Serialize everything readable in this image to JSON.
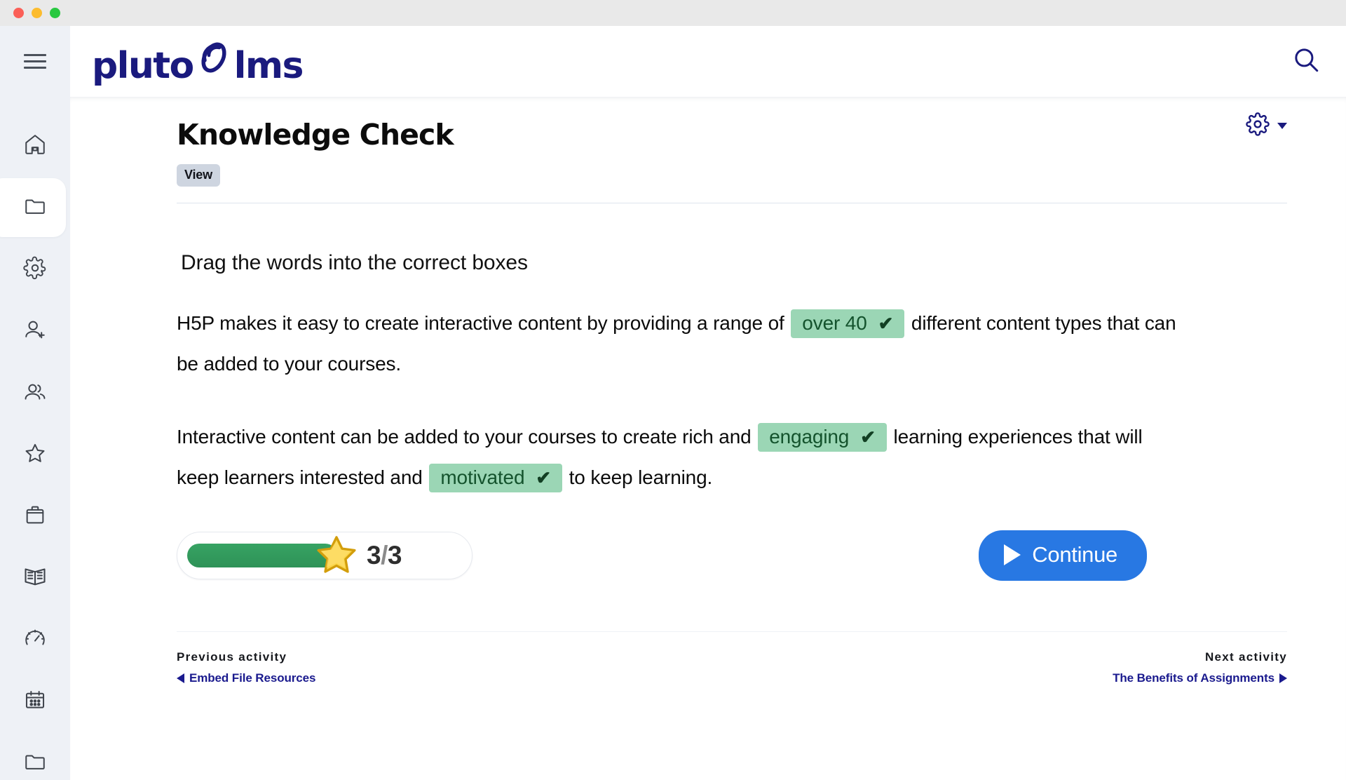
{
  "window": {
    "traffic_lights": [
      "close",
      "minimize",
      "zoom"
    ]
  },
  "sidebar": {
    "menu_toggle": "hamburger-menu",
    "items": [
      {
        "icon": "home-icon",
        "name": "home",
        "active": false
      },
      {
        "icon": "folder-icon",
        "name": "courses",
        "active": true
      },
      {
        "icon": "gear-icon",
        "name": "settings",
        "active": false
      },
      {
        "icon": "user-add-icon",
        "name": "add-user",
        "active": false
      },
      {
        "icon": "users-icon",
        "name": "users",
        "active": false
      },
      {
        "icon": "star-icon",
        "name": "favorites",
        "active": false
      },
      {
        "icon": "briefcase-icon",
        "name": "jobs",
        "active": false
      },
      {
        "icon": "book-open-icon",
        "name": "library",
        "active": false
      },
      {
        "icon": "gauge-icon",
        "name": "reports",
        "active": false
      },
      {
        "icon": "calendar-icon",
        "name": "calendar",
        "active": false
      },
      {
        "icon": "folder-icon",
        "name": "files",
        "active": false
      }
    ]
  },
  "topbar": {
    "logo_left": "pluto",
    "logo_right": "lms",
    "logo_mark": "pluto-swirl-icon",
    "search_icon": "search-icon"
  },
  "page": {
    "title": "Knowledge Check",
    "badge": "View",
    "settings_icon": "gear-icon",
    "settings_caret": "chevron-down-icon"
  },
  "h5p": {
    "instructions": "Drag the words into the correct boxes",
    "paragraphs": [
      {
        "before": "H5P makes it easy to create interactive content by providing a range of",
        "blank": "over 40",
        "after": "different content types that can be added to your courses.",
        "tick": "✔"
      },
      {
        "before": "Interactive content can be added to your courses to create rich and",
        "blank": "engaging",
        "middle": "learning experiences that will keep learners interested and",
        "blank2": "motivated",
        "after": "to keep learning.",
        "tick": "✔"
      }
    ],
    "score": {
      "current": "3",
      "separator": "/",
      "total": "3",
      "percent": 100,
      "star_icon": "star-icon"
    },
    "continue_label": "Continue",
    "continue_icon": "play-icon"
  },
  "footer": {
    "previous_kicker": "Previous activity",
    "previous_label": "Embed File Resources",
    "previous_icon": "arrow-left-icon",
    "next_kicker": "Next activity",
    "next_label": "The Benefits of Assignments",
    "next_icon": "arrow-right-icon"
  },
  "colors": {
    "brand_navy": "#1a1a7e",
    "sidebar_bg": "#eef1f6",
    "blank_green": "#9bd6b5",
    "blank_text": "#14532d",
    "progress_green": "#2e9257",
    "continue_blue": "#2878e3",
    "badge_gray": "#ced5e0"
  }
}
